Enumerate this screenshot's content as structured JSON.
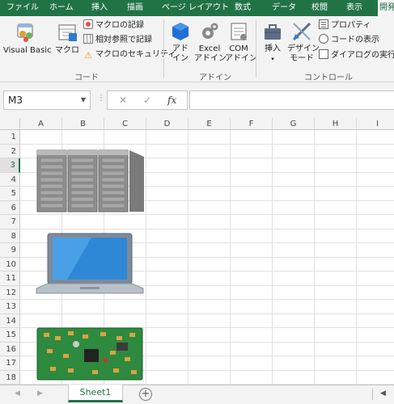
{
  "tabs": [
    "ファイル",
    "ホーム",
    "挿入",
    "描画",
    "ページ レイアウト",
    "数式",
    "データ",
    "校閲",
    "表示",
    "開発"
  ],
  "ribbon": {
    "code": {
      "visual_basic": "Visual Basic",
      "macro": "マクロ",
      "record_macro": "マクロの記録",
      "relative_ref": "相対参照で記録",
      "macro_security": "マクロのセキュリティ",
      "group_label": "コード"
    },
    "addins": {
      "addin_line1": "アド",
      "addin_line2": "イン",
      "excel_line1": "Excel",
      "excel_line2": "アドイン",
      "com_line1": "COM",
      "com_line2": "アドイン",
      "group_label": "アドイン"
    },
    "controls": {
      "insert": "挿入",
      "design_line1": "デザイン",
      "design_line2": "モード",
      "properties": "プロパティ",
      "view_code": "コードの表示",
      "run_dialog": "ダイアログの実行",
      "group_label": "コントロール"
    }
  },
  "formula_bar": {
    "name_box": "M3",
    "cancel": "✕",
    "enter": "✓",
    "fx": "fx",
    "value": ""
  },
  "columns": [
    "A",
    "B",
    "C",
    "D",
    "E",
    "F",
    "G",
    "H",
    "I"
  ],
  "rows": [
    "1",
    "2",
    "3",
    "4",
    "5",
    "6",
    "7",
    "8",
    "9",
    "10",
    "11",
    "12",
    "13",
    "14",
    "15",
    "16",
    "17",
    "18"
  ],
  "selected_row": "3",
  "sheet": {
    "tab_label": "Sheet1",
    "add_label": "+"
  },
  "colors": {
    "excel_green": "#217346",
    "ribbon_bg": "#f3f3f3"
  }
}
